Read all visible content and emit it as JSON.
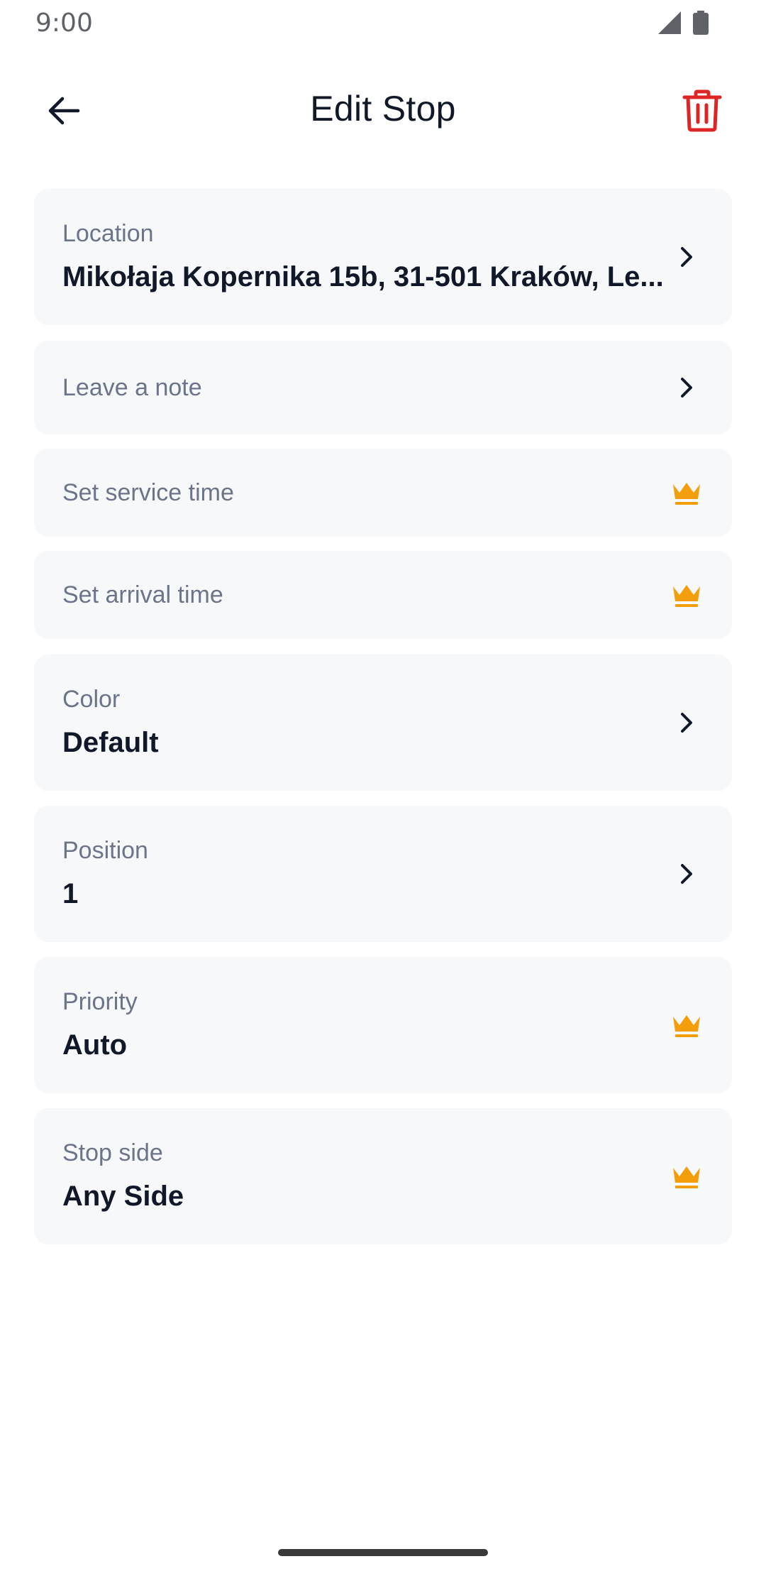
{
  "status_bar": {
    "time": "9:00",
    "signal_icon": "signal-icon",
    "battery_icon": "battery-icon"
  },
  "header": {
    "title": "Edit Stop",
    "back_icon": "arrow-left-icon",
    "delete_icon": "trash-icon",
    "delete_color": "#dc2626"
  },
  "fields": {
    "location": {
      "label": "Location",
      "value": "Mikołaja Kopernika 15b, 31-501 Kraków, Le...",
      "icon": "chevron-right-icon"
    },
    "note": {
      "label": "Leave a note",
      "icon": "chevron-right-icon"
    },
    "service_time": {
      "label": "Set service time",
      "icon": "crown-icon"
    },
    "arrival_time": {
      "label": "Set arrival time",
      "icon": "crown-icon"
    },
    "color": {
      "label": "Color",
      "value": "Default",
      "icon": "chevron-right-icon"
    },
    "position": {
      "label": "Position",
      "value": "1",
      "icon": "chevron-right-icon"
    },
    "priority": {
      "label": "Priority",
      "value": "Auto",
      "icon": "crown-icon"
    },
    "stop_side": {
      "label": "Stop side",
      "value": "Any Side",
      "icon": "crown-icon"
    }
  },
  "colors": {
    "card_background": "#f7f8fa",
    "label_text": "#6b7488",
    "value_text": "#111827",
    "premium_crown": "#f59e0b",
    "delete": "#dc2626"
  }
}
